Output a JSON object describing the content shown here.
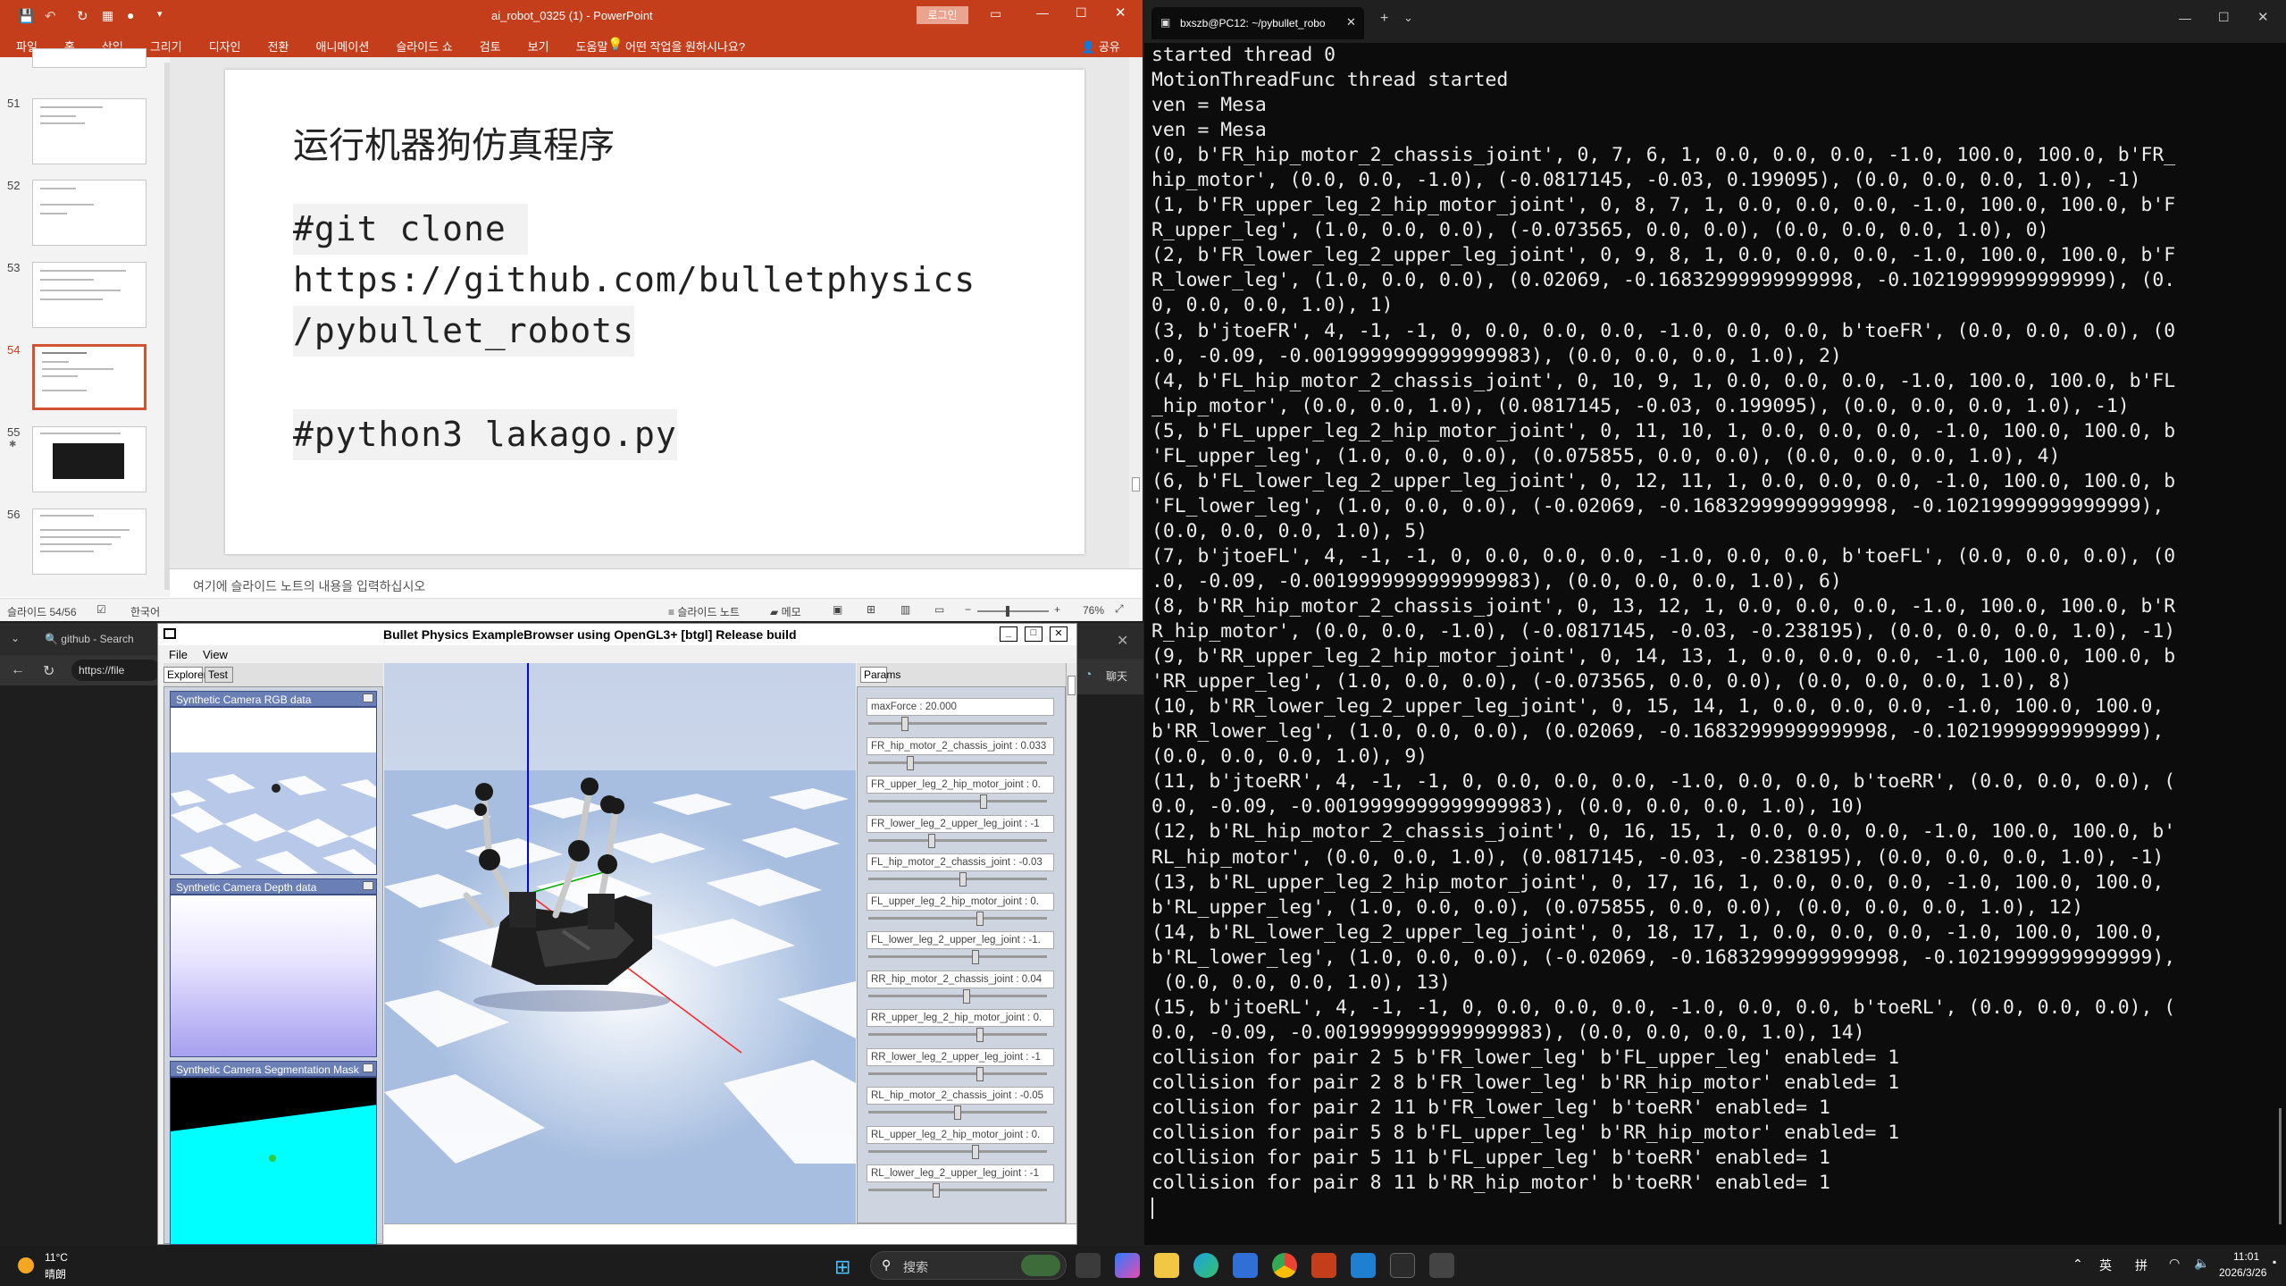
{
  "ppt": {
    "qat_icons": [
      "save-icon",
      "undo-icon",
      "redo-icon",
      "format-painter-icon",
      "accessibility-icon",
      "dropdown-icon"
    ],
    "title": "ai_robot_0325 (1) -  PowerPoint",
    "login_button": "로그인",
    "menu": [
      "파일",
      "홈",
      "삽입",
      "그리기",
      "디자인",
      "전환",
      "애니메이션",
      "슬라이드 쇼",
      "검토",
      "보기",
      "도움말"
    ],
    "tell_me": "어떤 작업을 원하시나요?",
    "share": "공유",
    "thumb_numbers": [
      "51",
      "52",
      "53",
      "54",
      "55",
      "56"
    ],
    "slide": {
      "title": "运行机器狗仿真程序",
      "line1": "#git clone ",
      "line2": "https://github.com/bulletphysics",
      "line3": "/pybullet_robots",
      "line4": "#python3 lakago.py"
    },
    "notes_placeholder": "여기에 슬라이드 노트의 내용을 입력하십시오",
    "status": {
      "slide_count": "슬라이드 54/56",
      "language": "한국어",
      "notes": "슬라이드 노트",
      "comments": "메모",
      "zoom": "76%"
    }
  },
  "browser": {
    "tab": "github - Search",
    "url": "https://file"
  },
  "bullet": {
    "title": "Bullet Physics ExampleBrowser using OpenGL3+ [btgl] Release build",
    "menu": [
      "File",
      "View"
    ],
    "tabs": [
      "Explorer",
      "Test"
    ],
    "params_tab": "Params",
    "camera_panels": [
      "Synthetic Camera RGB data",
      "Synthetic Camera Depth data",
      "Synthetic Camera Segmentation Mask"
    ],
    "params": [
      {
        "label": "maxForce : 20.000",
        "value": 0.2
      },
      {
        "label": "FR_hip_motor_2_chassis_joint : 0.033",
        "value": 0.23
      },
      {
        "label": "FR_upper_leg_2_hip_motor_joint : 0.",
        "value": 0.65
      },
      {
        "label": "FR_lower_leg_2_upper_leg_joint : -1",
        "value": 0.35
      },
      {
        "label": "FL_hip_motor_2_chassis_joint : -0.03",
        "value": 0.53
      },
      {
        "label": "FL_upper_leg_2_hip_motor_joint : 0.",
        "value": 0.63
      },
      {
        "label": "FL_lower_leg_2_upper_leg_joint : -1.",
        "value": 0.6
      },
      {
        "label": "RR_hip_motor_2_chassis_joint : 0.04",
        "value": 0.55
      },
      {
        "label": "RR_upper_leg_2_hip_motor_joint : 0.",
        "value": 0.63
      },
      {
        "label": "RR_lower_leg_2_upper_leg_joint : -1",
        "value": 0.63
      },
      {
        "label": "RL_hip_motor_2_chassis_joint : -0.05",
        "value": 0.5
      },
      {
        "label": "RL_upper_leg_2_hip_motor_joint : 0.",
        "value": 0.6
      },
      {
        "label": "RL_lower_leg_2_upper_leg_joint : -1",
        "value": 0.38
      }
    ]
  },
  "terminal": {
    "tab_title": "bxszb@PC12: ~/pybullet_robo",
    "lines": [
      "started thread 0",
      "MotionThreadFunc thread started",
      "ven = Mesa",
      "ven = Mesa",
      "(0, b'FR_hip_motor_2_chassis_joint', 0, 7, 6, 1, 0.0, 0.0, 0.0, -1.0, 100.0, 100.0, b'FR_",
      "hip_motor', (0.0, 0.0, -1.0), (-0.0817145, -0.03, 0.199095), (0.0, 0.0, 0.0, 1.0), -1)",
      "(1, b'FR_upper_leg_2_hip_motor_joint', 0, 8, 7, 1, 0.0, 0.0, 0.0, -1.0, 100.0, 100.0, b'F",
      "R_upper_leg', (1.0, 0.0, 0.0), (-0.073565, 0.0, 0.0), (0.0, 0.0, 0.0, 1.0), 0)",
      "(2, b'FR_lower_leg_2_upper_leg_joint', 0, 9, 8, 1, 0.0, 0.0, 0.0, -1.0, 100.0, 100.0, b'F",
      "R_lower_leg', (1.0, 0.0, 0.0), (0.02069, -0.16832999999999998, -0.10219999999999999), (0.",
      "0, 0.0, 0.0, 1.0), 1)",
      "(3, b'jtoeFR', 4, -1, -1, 0, 0.0, 0.0, 0.0, -1.0, 0.0, 0.0, b'toeFR', (0.0, 0.0, 0.0), (0",
      ".0, -0.09, -0.0019999999999999983), (0.0, 0.0, 0.0, 1.0), 2)",
      "(4, b'FL_hip_motor_2_chassis_joint', 0, 10, 9, 1, 0.0, 0.0, 0.0, -1.0, 100.0, 100.0, b'FL",
      "_hip_motor', (0.0, 0.0, 1.0), (0.0817145, -0.03, 0.199095), (0.0, 0.0, 0.0, 1.0), -1)",
      "(5, b'FL_upper_leg_2_hip_motor_joint', 0, 11, 10, 1, 0.0, 0.0, 0.0, -1.0, 100.0, 100.0, b",
      "'FL_upper_leg', (1.0, 0.0, 0.0), (0.075855, 0.0, 0.0), (0.0, 0.0, 0.0, 1.0), 4)",
      "(6, b'FL_lower_leg_2_upper_leg_joint', 0, 12, 11, 1, 0.0, 0.0, 0.0, -1.0, 100.0, 100.0, b",
      "'FL_lower_leg', (1.0, 0.0, 0.0), (-0.02069, -0.16832999999999998, -0.10219999999999999),",
      "(0.0, 0.0, 0.0, 1.0), 5)",
      "(7, b'jtoeFL', 4, -1, -1, 0, 0.0, 0.0, 0.0, -1.0, 0.0, 0.0, b'toeFL', (0.0, 0.0, 0.0), (0",
      ".0, -0.09, -0.0019999999999999983), (0.0, 0.0, 0.0, 1.0), 6)",
      "(8, b'RR_hip_motor_2_chassis_joint', 0, 13, 12, 1, 0.0, 0.0, 0.0, -1.0, 100.0, 100.0, b'R",
      "R_hip_motor', (0.0, 0.0, -1.0), (-0.0817145, -0.03, -0.238195), (0.0, 0.0, 0.0, 1.0), -1)",
      "(9, b'RR_upper_leg_2_hip_motor_joint', 0, 14, 13, 1, 0.0, 0.0, 0.0, -1.0, 100.0, 100.0, b",
      "'RR_upper_leg', (1.0, 0.0, 0.0), (-0.073565, 0.0, 0.0), (0.0, 0.0, 0.0, 1.0), 8)",
      "(10, b'RR_lower_leg_2_upper_leg_joint', 0, 15, 14, 1, 0.0, 0.0, 0.0, -1.0, 100.0, 100.0,",
      "b'RR_lower_leg', (1.0, 0.0, 0.0), (0.02069, -0.16832999999999998, -0.10219999999999999),",
      "(0.0, 0.0, 0.0, 1.0), 9)",
      "(11, b'jtoeRR', 4, -1, -1, 0, 0.0, 0.0, 0.0, -1.0, 0.0, 0.0, b'toeRR', (0.0, 0.0, 0.0), (",
      "0.0, -0.09, -0.0019999999999999983), (0.0, 0.0, 0.0, 1.0), 10)",
      "(12, b'RL_hip_motor_2_chassis_joint', 0, 16, 15, 1, 0.0, 0.0, 0.0, -1.0, 100.0, 100.0, b'",
      "RL_hip_motor', (0.0, 0.0, 1.0), (0.0817145, -0.03, -0.238195), (0.0, 0.0, 0.0, 1.0), -1)",
      "(13, b'RL_upper_leg_2_hip_motor_joint', 0, 17, 16, 1, 0.0, 0.0, 0.0, -1.0, 100.0, 100.0,",
      "b'RL_upper_leg', (1.0, 0.0, 0.0), (0.075855, 0.0, 0.0), (0.0, 0.0, 0.0, 1.0), 12)",
      "(14, b'RL_lower_leg_2_upper_leg_joint', 0, 18, 17, 1, 0.0, 0.0, 0.0, -1.0, 100.0, 100.0,",
      "b'RL_lower_leg', (1.0, 0.0, 0.0), (-0.02069, -0.16832999999999998, -0.10219999999999999),",
      " (0.0, 0.0, 0.0, 1.0), 13)",
      "(15, b'jtoeRL', 4, -1, -1, 0, 0.0, 0.0, 0.0, -1.0, 0.0, 0.0, b'toeRL', (0.0, 0.0, 0.0), (",
      "0.0, -0.09, -0.0019999999999999983), (0.0, 0.0, 0.0, 1.0), 14)",
      "collision for pair 2 5 b'FR_lower_leg' b'FL_upper_leg' enabled= 1",
      "collision for pair 2 8 b'FR_lower_leg' b'RR_hip_motor' enabled= 1",
      "collision for pair 2 11 b'FR_lower_leg' b'toeRR' enabled= 1",
      "collision for pair 5 8 b'FL_upper_leg' b'RR_hip_motor' enabled= 1",
      "collision for pair 5 11 b'FL_upper_leg' b'toeRR' enabled= 1",
      "collision for pair 8 11 b'RR_hip_motor' b'toeRR' enabled= 1"
    ]
  },
  "taskbar": {
    "weather_temp": "11°C",
    "weather_desc": "晴朗",
    "search": "搜索",
    "ime1": "英",
    "ime2": "拼",
    "time": "11:01",
    "date": "2026/3/26",
    "side_label": "聊天"
  },
  "colors": {
    "ppt_accent": "#c43e1c",
    "terminal_bg": "#0c0c0c",
    "selected_slide": "#d35230"
  }
}
